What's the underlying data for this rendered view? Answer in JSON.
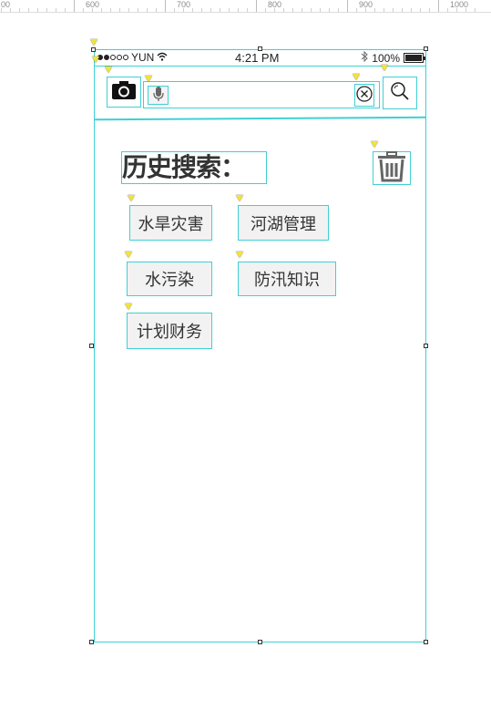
{
  "ruler": {
    "labels": [
      "00",
      "600",
      "700",
      "800",
      "900",
      "1000"
    ]
  },
  "statusbar": {
    "carrier": "YUN",
    "time": "4:21 PM",
    "battery": "100%",
    "signal_bars_full": 2,
    "signal_bars_total": 5
  },
  "searchbar": {
    "camera_icon": "camera-icon",
    "mic_icon": "microphone-icon",
    "clear_icon": "clear-circle-icon",
    "search_icon": "search-icon",
    "search_value": ""
  },
  "history": {
    "title": "历史搜索：",
    "trash_icon": "trash-icon",
    "tags": [
      "水旱灾害",
      "河湖管理",
      "水污染",
      "防汛知识",
      "计划财务"
    ]
  },
  "colors": {
    "frame_border": "#3fd0d4",
    "tag_bg": "#f2f2f2",
    "text": "#333333",
    "marker": "#f2e33c"
  }
}
